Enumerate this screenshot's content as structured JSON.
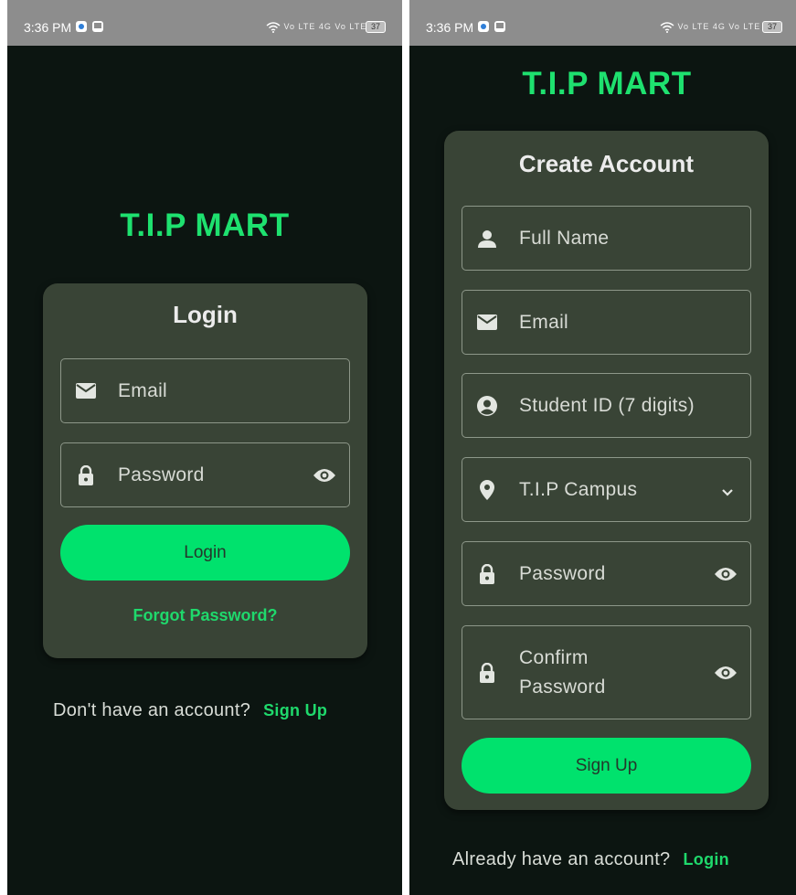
{
  "status_bar": {
    "time": "3:36 PM",
    "signal_text": "Vo LTE 4G Vo LTE 4G",
    "battery": "37"
  },
  "colors": {
    "background": "#0c1511",
    "card": "#394436",
    "accent": "#1ee16f",
    "button": "#00e26d"
  },
  "login_screen": {
    "brand": "T.I.P MART",
    "title": "Login",
    "email_field": {
      "placeholder": "Email",
      "icon": "mail-icon"
    },
    "password_field": {
      "placeholder": "Password",
      "icon": "lock-icon",
      "toggle_icon": "eye-icon"
    },
    "login_button": "Login",
    "forgot_link": "Forgot Password?",
    "footer_text": "Don't have an account?",
    "footer_link": "Sign Up"
  },
  "signup_screen": {
    "brand": "T.I.P MART",
    "title": "Create Account",
    "fields": {
      "full_name": {
        "placeholder": "Full Name",
        "icon": "person-icon"
      },
      "email": {
        "placeholder": "Email",
        "icon": "mail-icon"
      },
      "student_id": {
        "placeholder": "Student ID (7 digits)",
        "icon": "account-circle-icon"
      },
      "campus": {
        "value": "T.I.P Campus",
        "icon": "location-pin-icon",
        "dropdown_icon": "chevron-down-icon"
      },
      "password": {
        "placeholder": "Password",
        "icon": "lock-icon",
        "toggle_icon": "eye-icon"
      },
      "confirm_password": {
        "placeholder": "Confirm Password",
        "icon": "lock-icon",
        "toggle_icon": "eye-icon"
      }
    },
    "signup_button": "Sign Up",
    "footer_text": "Already have an account?",
    "footer_link": "Login"
  }
}
